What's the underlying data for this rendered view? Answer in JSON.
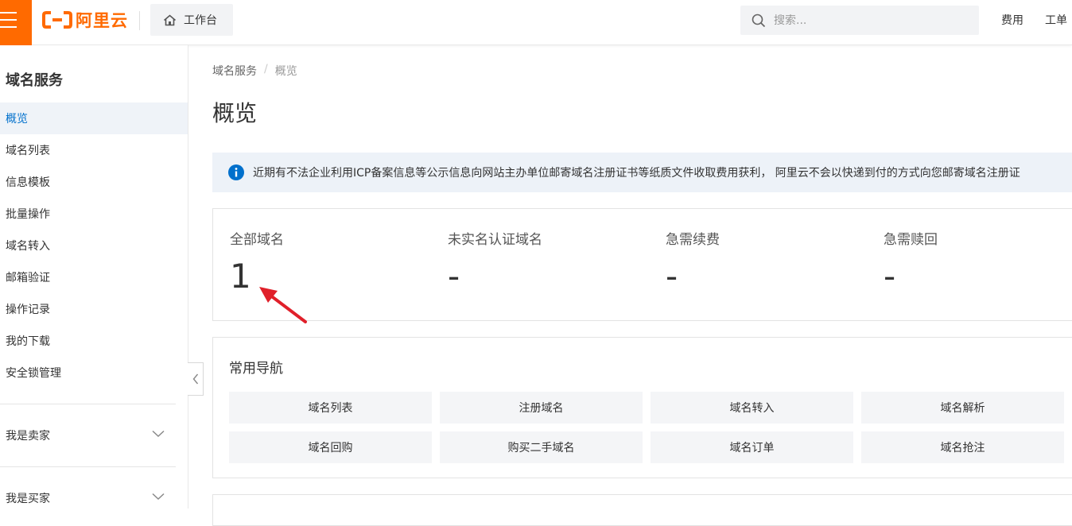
{
  "header": {
    "logo_text": "阿里云",
    "workbench_label": "工作台",
    "search_placeholder": "搜索...",
    "links": [
      "费用",
      "工单"
    ],
    "brand_color": "#ff6a00"
  },
  "sidebar": {
    "title": "域名服务",
    "items": [
      {
        "label": "概览",
        "active": true
      },
      {
        "label": "域名列表"
      },
      {
        "label": "信息模板"
      },
      {
        "label": "批量操作"
      },
      {
        "label": "域名转入"
      },
      {
        "label": "邮箱验证"
      },
      {
        "label": "操作记录"
      },
      {
        "label": "我的下载"
      },
      {
        "label": "安全锁管理"
      }
    ],
    "groups": [
      {
        "label": "我是卖家"
      },
      {
        "label": "我是买家"
      }
    ]
  },
  "breadcrumb": [
    "域名服务",
    "概览"
  ],
  "page_title": "概览",
  "notice": {
    "text": "近期有不法企业利用ICP备案信息等公示信息向网站主办单位邮寄域名注册证书等纸质文件收取费用获利， 阿里云不会以快递到付的方式向您邮寄域名注册证"
  },
  "stats": [
    {
      "label": "全部域名",
      "value": "1"
    },
    {
      "label": "未实名认证域名",
      "value": "-"
    },
    {
      "label": "急需续费",
      "value": "-"
    },
    {
      "label": "急需赎回",
      "value": "-"
    }
  ],
  "nav": {
    "title": "常用导航",
    "buttons": [
      "域名列表",
      "注册域名",
      "域名转入",
      "域名解析",
      "域名回购",
      "购买二手域名",
      "域名订单",
      "域名抢注"
    ]
  },
  "accent_color": "#0070cc",
  "annotation_color": "#e0202a"
}
